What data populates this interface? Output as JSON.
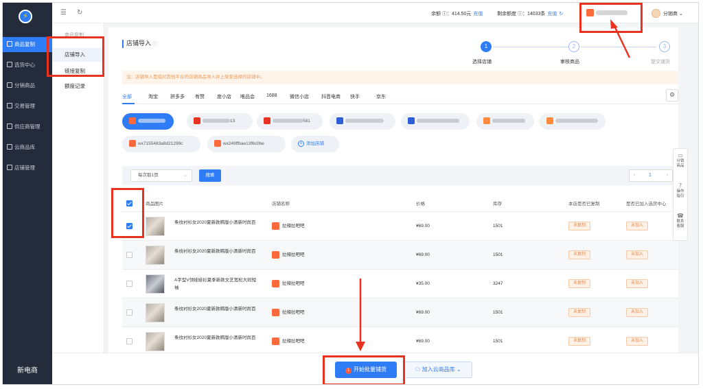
{
  "sidebar": {
    "logo_glyph": "⚡",
    "items": [
      {
        "label": "商品复制",
        "active": true
      },
      {
        "label": "选货中心",
        "active": false
      },
      {
        "label": "分销商品",
        "active": false
      },
      {
        "label": "交易管理",
        "active": false
      },
      {
        "label": "供应商管理",
        "active": false
      },
      {
        "label": "云商品库",
        "active": false
      },
      {
        "label": "店铺管理",
        "active": false
      }
    ],
    "brand": "新电商"
  },
  "subnav": {
    "heading": "商品复制",
    "items": [
      {
        "label": "店铺导入",
        "active": true
      },
      {
        "label": "链接复制",
        "active": false
      },
      {
        "label": "额度记录",
        "active": false
      }
    ]
  },
  "topbar": {
    "menu_icon": "☰",
    "refresh_icon": "↻",
    "balance": "余额 ⓘ：414.50元",
    "recharge": "充值",
    "quota": "剩余额度 ⓘ：14033条",
    "quota_recharge": "充值",
    "user": "分销商"
  },
  "page": {
    "title": "店铺导入",
    "help": "ⓘ",
    "steps": [
      {
        "num": "1",
        "label": "选择店铺",
        "active": true
      },
      {
        "num": "2",
        "label": "审核商品",
        "active": false
      },
      {
        "num": "3",
        "label": "提交铺货",
        "active": false
      }
    ],
    "notice": "注：店铺导入是指对其他平台的店铺商品导入并上架至选择的店铺中。",
    "tabs": [
      "全部",
      "淘宝",
      "拼多多",
      "有赞",
      "度小店",
      "唯品会",
      "1688",
      "微信小店",
      "抖音电商",
      "快手",
      "京东"
    ],
    "settings_icon": "⚙",
    "shops": [
      {
        "text": "",
        "color": "#ff6a3c",
        "active": true
      },
      {
        "text": "13",
        "color": "#e8321f",
        "active": false
      },
      {
        "text": "581",
        "color": "#e8321f",
        "active": false
      },
      {
        "text": "",
        "color": "#2f5fd6",
        "active": false
      },
      {
        "text": "",
        "color": "#2f5fd6",
        "active": false
      },
      {
        "text": "",
        "color": "#ff8a3c",
        "active": false
      },
      {
        "text": "",
        "color": "#ff8a3c",
        "active": false
      }
    ],
    "shops_row2": [
      {
        "text": "wx7155483a8d21299c",
        "color": "#ff6a3c"
      },
      {
        "text": "wx249ffbae13f6c0be",
        "color": "#ff6a3c"
      }
    ],
    "add_shop": "添加店铺",
    "filter": {
      "select_value": "每次取1页",
      "search_label": "搜索",
      "page": "1"
    },
    "table": {
      "headers": [
        "商品图片",
        "店铺名称",
        "价格",
        "库存",
        "本店是否已复制",
        "是否已加入选货中心"
      ],
      "rows": [
        {
          "checked": true,
          "title": "条纹衬衫女2020夏新款韩版小清新时尚百",
          "store": "拉辣拉吧吧",
          "price": "¥69.00",
          "stock": "1501",
          "copied": "未复制",
          "joined": "未加入",
          "thumb": "warm"
        },
        {
          "checked": false,
          "title": "条纹衬衫女2020夏新款韩版小清新时尚百",
          "store": "拉辣拉吧吧",
          "price": "¥69.00",
          "stock": "1501",
          "copied": "未复制",
          "joined": "未加入",
          "thumb": "warm"
        },
        {
          "checked": false,
          "title": "A字型V领娃娃衫夏季新款文艺宽松大码短袖",
          "store": "拉辣拉吧吧",
          "price": "¥35.00",
          "stock": "3247",
          "copied": "未复制",
          "joined": "未加入",
          "thumb": "gray"
        },
        {
          "checked": false,
          "title": "条纹衬衫女2020夏新款韩版小清新时尚百",
          "store": "拉辣拉吧吧",
          "price": "¥69.00",
          "stock": "1501",
          "copied": "未复制",
          "joined": "未加入",
          "thumb": "warm"
        },
        {
          "checked": false,
          "title": "条纹衬衫女2020夏新款韩版小清新时尚百",
          "store": "拉辣拉吧吧",
          "price": "¥69.00",
          "stock": "1501",
          "copied": "未复制",
          "joined": "未加入",
          "thumb": "warm"
        }
      ]
    }
  },
  "float_panel": [
    {
      "icon": "▭",
      "label": "分销\n商品"
    },
    {
      "icon": "?",
      "label": "操作\n指引"
    },
    {
      "icon": "☎",
      "label": "联系\n客服"
    }
  ],
  "bottom": {
    "primary_badge": "1",
    "primary": "开始批量铺货",
    "secondary": "加入云商品库 ⌄"
  }
}
